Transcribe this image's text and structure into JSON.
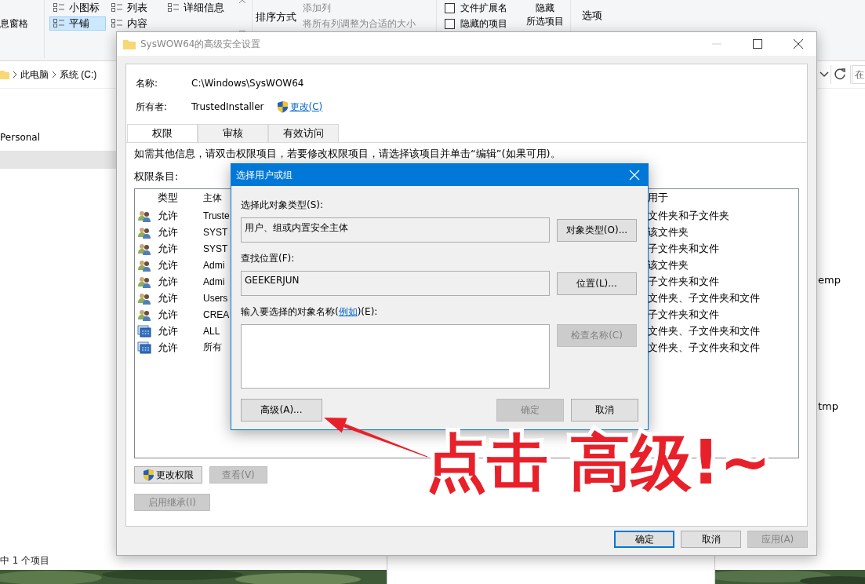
{
  "explorer": {
    "ribbon": {
      "pane_label": "息窗格",
      "layouts": [
        {
          "label": "小图标",
          "selected": false
        },
        {
          "label": "列表",
          "selected": false
        },
        {
          "label": "详细信息",
          "selected": false
        },
        {
          "label": "平铺",
          "selected": true
        },
        {
          "label": "内容",
          "selected": false
        }
      ],
      "sort_label": "排序方式",
      "add_column": "添加列",
      "size_columns": "将所有列调整为合适的大小",
      "checkboxes": [
        {
          "label": "文件扩展名",
          "checked": false
        },
        {
          "label": "隐藏的项目",
          "checked": false
        }
      ],
      "hide_selected": [
        "隐藏",
        "所选项目"
      ],
      "options": "选项"
    },
    "breadcrumb": [
      "此电脑",
      "系统 (C:)"
    ],
    "search_placeholder": "在",
    "nav_items": [
      {
        "label": "Personal",
        "selected": false
      }
    ],
    "files": [
      "emp",
      "tmp"
    ],
    "status": "中 1 个项目"
  },
  "security": {
    "title": "SysWOW64的高级安全设置",
    "name_label": "名称:",
    "name_value": "C:\\Windows\\SysWOW64",
    "owner_label": "所有者:",
    "owner_value": "TrustedInstaller",
    "change_link": "更改(C)",
    "tabs": [
      {
        "label": "权限",
        "selected": true
      },
      {
        "label": "审核",
        "selected": false
      },
      {
        "label": "有效访问",
        "selected": false
      }
    ],
    "info": "如需其他信息，请双击权限项目，若要修改权限项目，请选择该项目并单击“编辑”(如果可用)。",
    "entries_label": "权限条目:",
    "columns": [
      "类型",
      "主体",
      "用于"
    ],
    "entries": [
      {
        "kind": "user",
        "type": "允许",
        "principal": "Truste",
        "applies_to": "文件夹和子文件夹"
      },
      {
        "kind": "user",
        "type": "允许",
        "principal": "SYST",
        "applies_to": "该文件夹"
      },
      {
        "kind": "user",
        "type": "允许",
        "principal": "SYST",
        "applies_to": "子文件夹和文件"
      },
      {
        "kind": "user",
        "type": "允许",
        "principal": "Admi",
        "applies_to": "该文件夹"
      },
      {
        "kind": "user",
        "type": "允许",
        "principal": "Admi",
        "applies_to": "子文件夹和文件"
      },
      {
        "kind": "user",
        "type": "允许",
        "principal": "Users",
        "applies_to": "文件夹、子文件夹和文件"
      },
      {
        "kind": "user",
        "type": "允许",
        "principal": "CREA",
        "applies_to": "子文件夹和文件"
      },
      {
        "kind": "package",
        "type": "允许",
        "principal": "ALL",
        "applies_to": "文件夹、子文件夹和文件"
      },
      {
        "kind": "package",
        "type": "允许",
        "principal": "所有",
        "applies_to": "文件夹、子文件夹和文件"
      }
    ],
    "change_permissions": "更改权限",
    "view": {
      "label": "查看(V)",
      "disabled": true
    },
    "inherit": {
      "label": "启用继承(I)",
      "disabled": true
    },
    "buttons": [
      {
        "label": "确定",
        "default": true,
        "disabled": false
      },
      {
        "label": "取消",
        "default": false,
        "disabled": false
      },
      {
        "label": "应用(A)",
        "default": false,
        "disabled": true
      }
    ]
  },
  "select": {
    "title": "选择用户或组",
    "type_label": "选择此对象类型(S):",
    "type_value": "用户、组或内置安全主体",
    "type_button": "对象类型(O)...",
    "location_label": "查找位置(F):",
    "location_value": "GEEKERJUN",
    "location_button": "位置(L)...",
    "names_label_before": "输入要选择的对象名称(",
    "example_link": "例如",
    "names_label_after": ")(E):",
    "check_names": {
      "label": "检查名称(C)",
      "disabled": true
    },
    "advanced": "高级(A)...",
    "ok": {
      "label": "确定",
      "disabled": true
    },
    "cancel": "取消"
  },
  "annotation": {
    "text": "点击 高级!~"
  }
}
